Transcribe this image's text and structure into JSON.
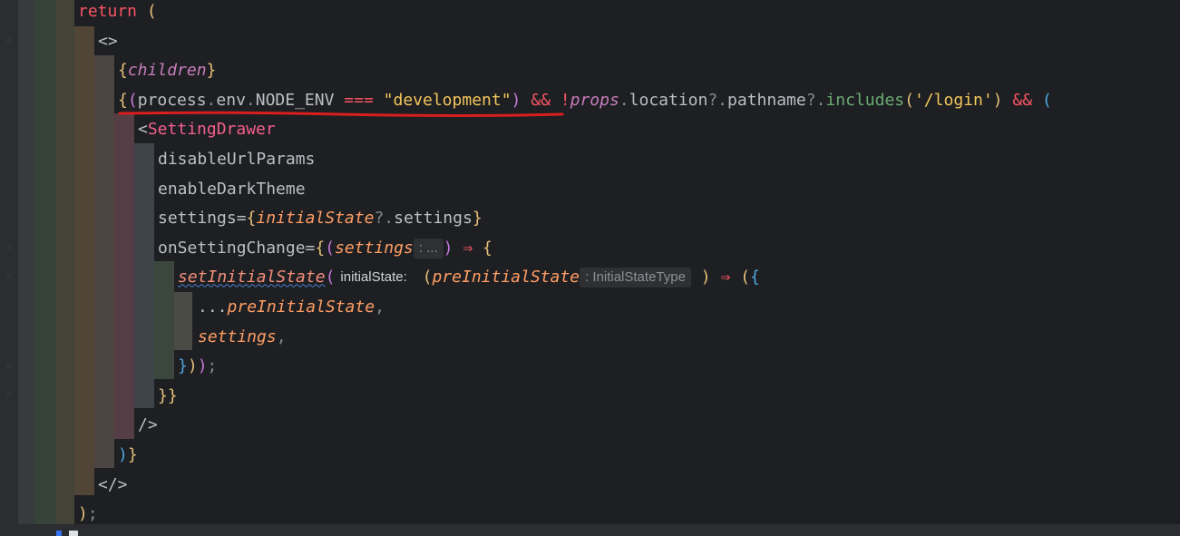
{
  "editor": {
    "lines": [
      {
        "segments": [
          {
            "cls": "kw-red",
            "text": "return"
          },
          {
            "cls": "ident",
            "text": " "
          },
          {
            "cls": "brace1",
            "text": "("
          }
        ]
      },
      {
        "segments": [
          {
            "cls": "ph",
            "text": "<>"
          }
        ]
      },
      {
        "segments": [
          {
            "cls": "brace1",
            "text": "{"
          },
          {
            "cls": "var-it",
            "text": "children"
          },
          {
            "cls": "brace1",
            "text": "}"
          }
        ]
      },
      {
        "segments": [
          {
            "cls": "brace1",
            "text": "{"
          },
          {
            "cls": "brace2",
            "text": "("
          },
          {
            "cls": "ident",
            "text": "process"
          },
          {
            "cls": "opt",
            "text": "."
          },
          {
            "cls": "ident",
            "text": "env"
          },
          {
            "cls": "opt",
            "text": "."
          },
          {
            "cls": "ident",
            "text": "NODE_ENV "
          },
          {
            "cls": "op",
            "text": "==="
          },
          {
            "cls": "ident",
            "text": " "
          },
          {
            "cls": "str",
            "text": "\"development\""
          },
          {
            "cls": "brace2",
            "text": ")"
          },
          {
            "cls": "ident",
            "text": " "
          },
          {
            "cls": "amp",
            "text": "&&"
          },
          {
            "cls": "ident",
            "text": " "
          },
          {
            "cls": "op",
            "text": "!"
          },
          {
            "cls": "var-it",
            "text": "props"
          },
          {
            "cls": "opt",
            "text": "."
          },
          {
            "cls": "ident",
            "text": "location"
          },
          {
            "cls": "opt",
            "text": "?."
          },
          {
            "cls": "ident",
            "text": "pathname"
          },
          {
            "cls": "opt",
            "text": "?."
          },
          {
            "cls": "str2",
            "text": "includes"
          },
          {
            "cls": "brace1",
            "text": "("
          },
          {
            "cls": "str",
            "text": "'/login'"
          },
          {
            "cls": "brace1",
            "text": ")"
          },
          {
            "cls": "ident",
            "text": " "
          },
          {
            "cls": "amp",
            "text": "&&"
          },
          {
            "cls": "ident",
            "text": " "
          },
          {
            "cls": "brace3",
            "text": "("
          }
        ]
      },
      {
        "segments": [
          {
            "cls": "ph",
            "text": "<"
          },
          {
            "cls": "comp",
            "text": "SettingDrawer"
          }
        ]
      },
      {
        "segments": [
          {
            "cls": "attr",
            "text": "disableUrlParams"
          }
        ]
      },
      {
        "segments": [
          {
            "cls": "attr",
            "text": "enableDarkTheme"
          }
        ]
      },
      {
        "segments": [
          {
            "cls": "attr",
            "text": "settings="
          },
          {
            "cls": "brace1",
            "text": "{"
          },
          {
            "cls": "param",
            "text": "initialState"
          },
          {
            "cls": "opt",
            "text": "?."
          },
          {
            "cls": "ident",
            "text": "settings"
          },
          {
            "cls": "brace1",
            "text": "}"
          }
        ]
      },
      {
        "segments": [
          {
            "cls": "attr",
            "text": "onSettingChange="
          },
          {
            "cls": "brace1",
            "text": "{"
          },
          {
            "cls": "brace2",
            "text": "("
          },
          {
            "cls": "param",
            "text": "settings"
          },
          {
            "cls": "hint",
            "text": ": ..."
          },
          {
            "cls": "brace2",
            "text": ")"
          },
          {
            "cls": "ident",
            "text": " "
          },
          {
            "cls": "arrow",
            "text": "⇒"
          },
          {
            "cls": "ident",
            "text": " "
          },
          {
            "cls": "brace1",
            "text": "{"
          }
        ]
      },
      {
        "segments": [
          {
            "cls": "fncall",
            "text": "setInitialState"
          },
          {
            "cls": "brace2",
            "text": "("
          },
          {
            "cls": "hint-named",
            "text": "initialState:"
          },
          {
            "cls": "ident",
            "text": " "
          },
          {
            "cls": "brace1",
            "text": "("
          },
          {
            "cls": "param",
            "text": "preInitialState"
          },
          {
            "cls": "hint",
            "text": ": InitialStateType"
          },
          {
            "cls": "ident",
            "text": " "
          },
          {
            "cls": "brace1",
            "text": ")"
          },
          {
            "cls": "ident",
            "text": " "
          },
          {
            "cls": "arrow",
            "text": "⇒"
          },
          {
            "cls": "ident",
            "text": " "
          },
          {
            "cls": "brace1",
            "text": "("
          },
          {
            "cls": "brace3",
            "text": "{"
          }
        ]
      },
      {
        "segments": [
          {
            "cls": "ident",
            "text": "..."
          },
          {
            "cls": "param",
            "text": "preInitialState"
          },
          {
            "cls": "opt",
            "text": ","
          }
        ]
      },
      {
        "segments": [
          {
            "cls": "param",
            "text": "settings"
          },
          {
            "cls": "opt",
            "text": ","
          }
        ]
      },
      {
        "segments": [
          {
            "cls": "brace3",
            "text": "}"
          },
          {
            "cls": "brace1",
            "text": ")"
          },
          {
            "cls": "brace2",
            "text": ")"
          },
          {
            "cls": "opt",
            "text": ";"
          }
        ]
      },
      {
        "segments": [
          {
            "cls": "brace1",
            "text": "}}"
          }
        ]
      },
      {
        "segments": [
          {
            "cls": "ph",
            "text": "/>"
          }
        ]
      },
      {
        "segments": [
          {
            "cls": "brace3",
            "text": ")"
          },
          {
            "cls": "brace1",
            "text": "}"
          }
        ]
      },
      {
        "segments": [
          {
            "cls": "ph",
            "text": "</>"
          }
        ]
      },
      {
        "segments": [
          {
            "cls": "brace1",
            "text": ")"
          },
          {
            "cls": "opt",
            "text": ";"
          }
        ]
      }
    ]
  },
  "colors": {
    "background": "#1e1f22",
    "annotation_underline": "#d81e1e"
  }
}
